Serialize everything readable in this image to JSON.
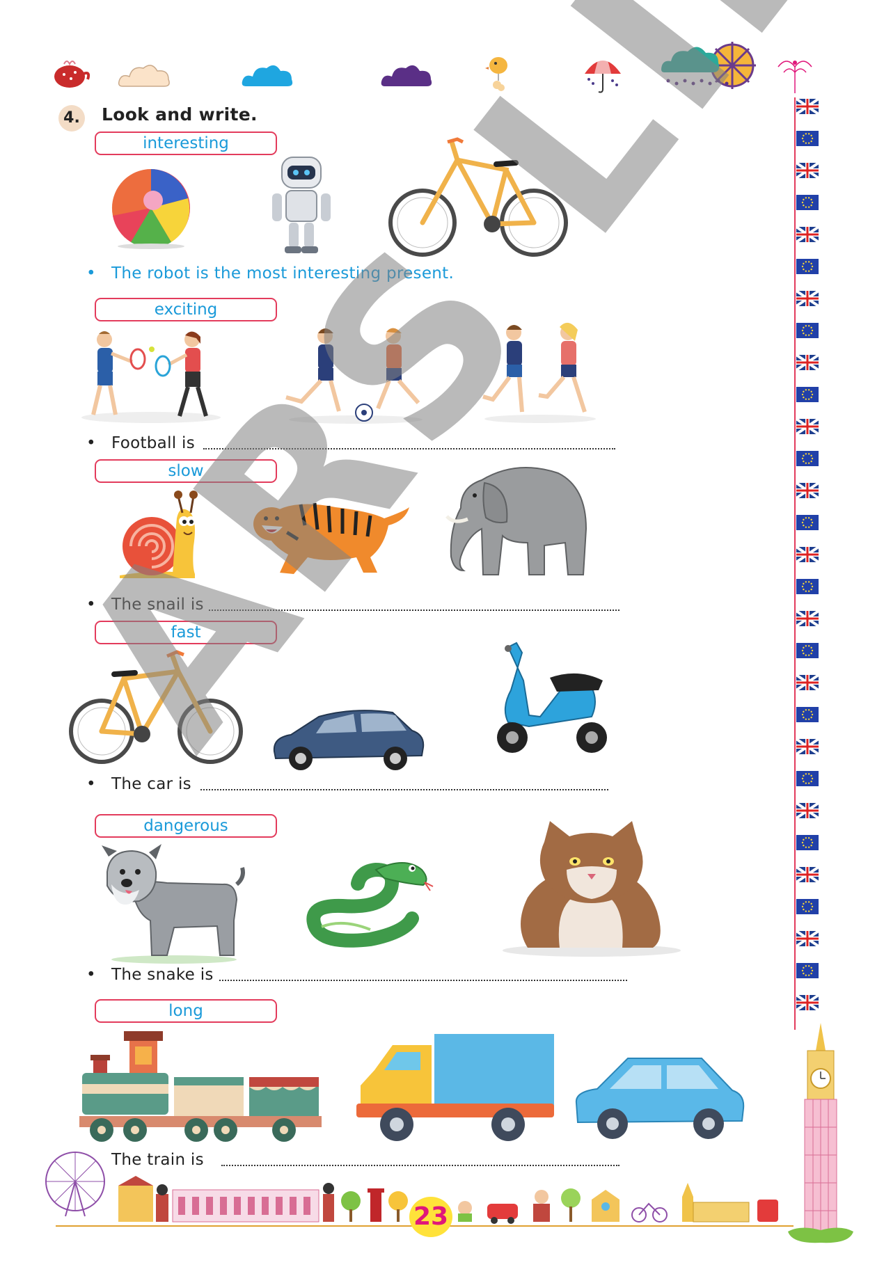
{
  "exercise": {
    "number": "4.",
    "instruction": "Look and write."
  },
  "sections": [
    {
      "word": "interesting",
      "sentence": "The robot is the most interesting present.",
      "answered": true
    },
    {
      "word": "exciting",
      "sentence": "Football is"
    },
    {
      "word": "slow",
      "sentence": "The snail is"
    },
    {
      "word": "fast",
      "sentence": "The car is"
    },
    {
      "word": "dangerous",
      "sentence": "The snake is"
    },
    {
      "word": "long",
      "sentence": "The train is"
    }
  ],
  "watermark": "ARS LIBRI",
  "page_number": "23",
  "icons": {
    "header": [
      "teapot-icon",
      "cloud-icon",
      "cloud-icon",
      "cloud-icon",
      "bird-icon",
      "umbrella-icon",
      "rain-cloud-sun-icon"
    ],
    "pictures": [
      "ball",
      "robot",
      "bicycle",
      "tennis-players",
      "football-players",
      "runners",
      "snail",
      "tiger",
      "elephant",
      "bicycle",
      "car",
      "scooter",
      "dog",
      "snake",
      "cat",
      "train",
      "truck",
      "car"
    ]
  },
  "colors": {
    "box_border": "#e33b5c",
    "word_text": "#1a9ad9",
    "answer_text": "#1a9ad9",
    "page_number_bg": "#ffe23a",
    "page_number_text": "#e0177a"
  }
}
